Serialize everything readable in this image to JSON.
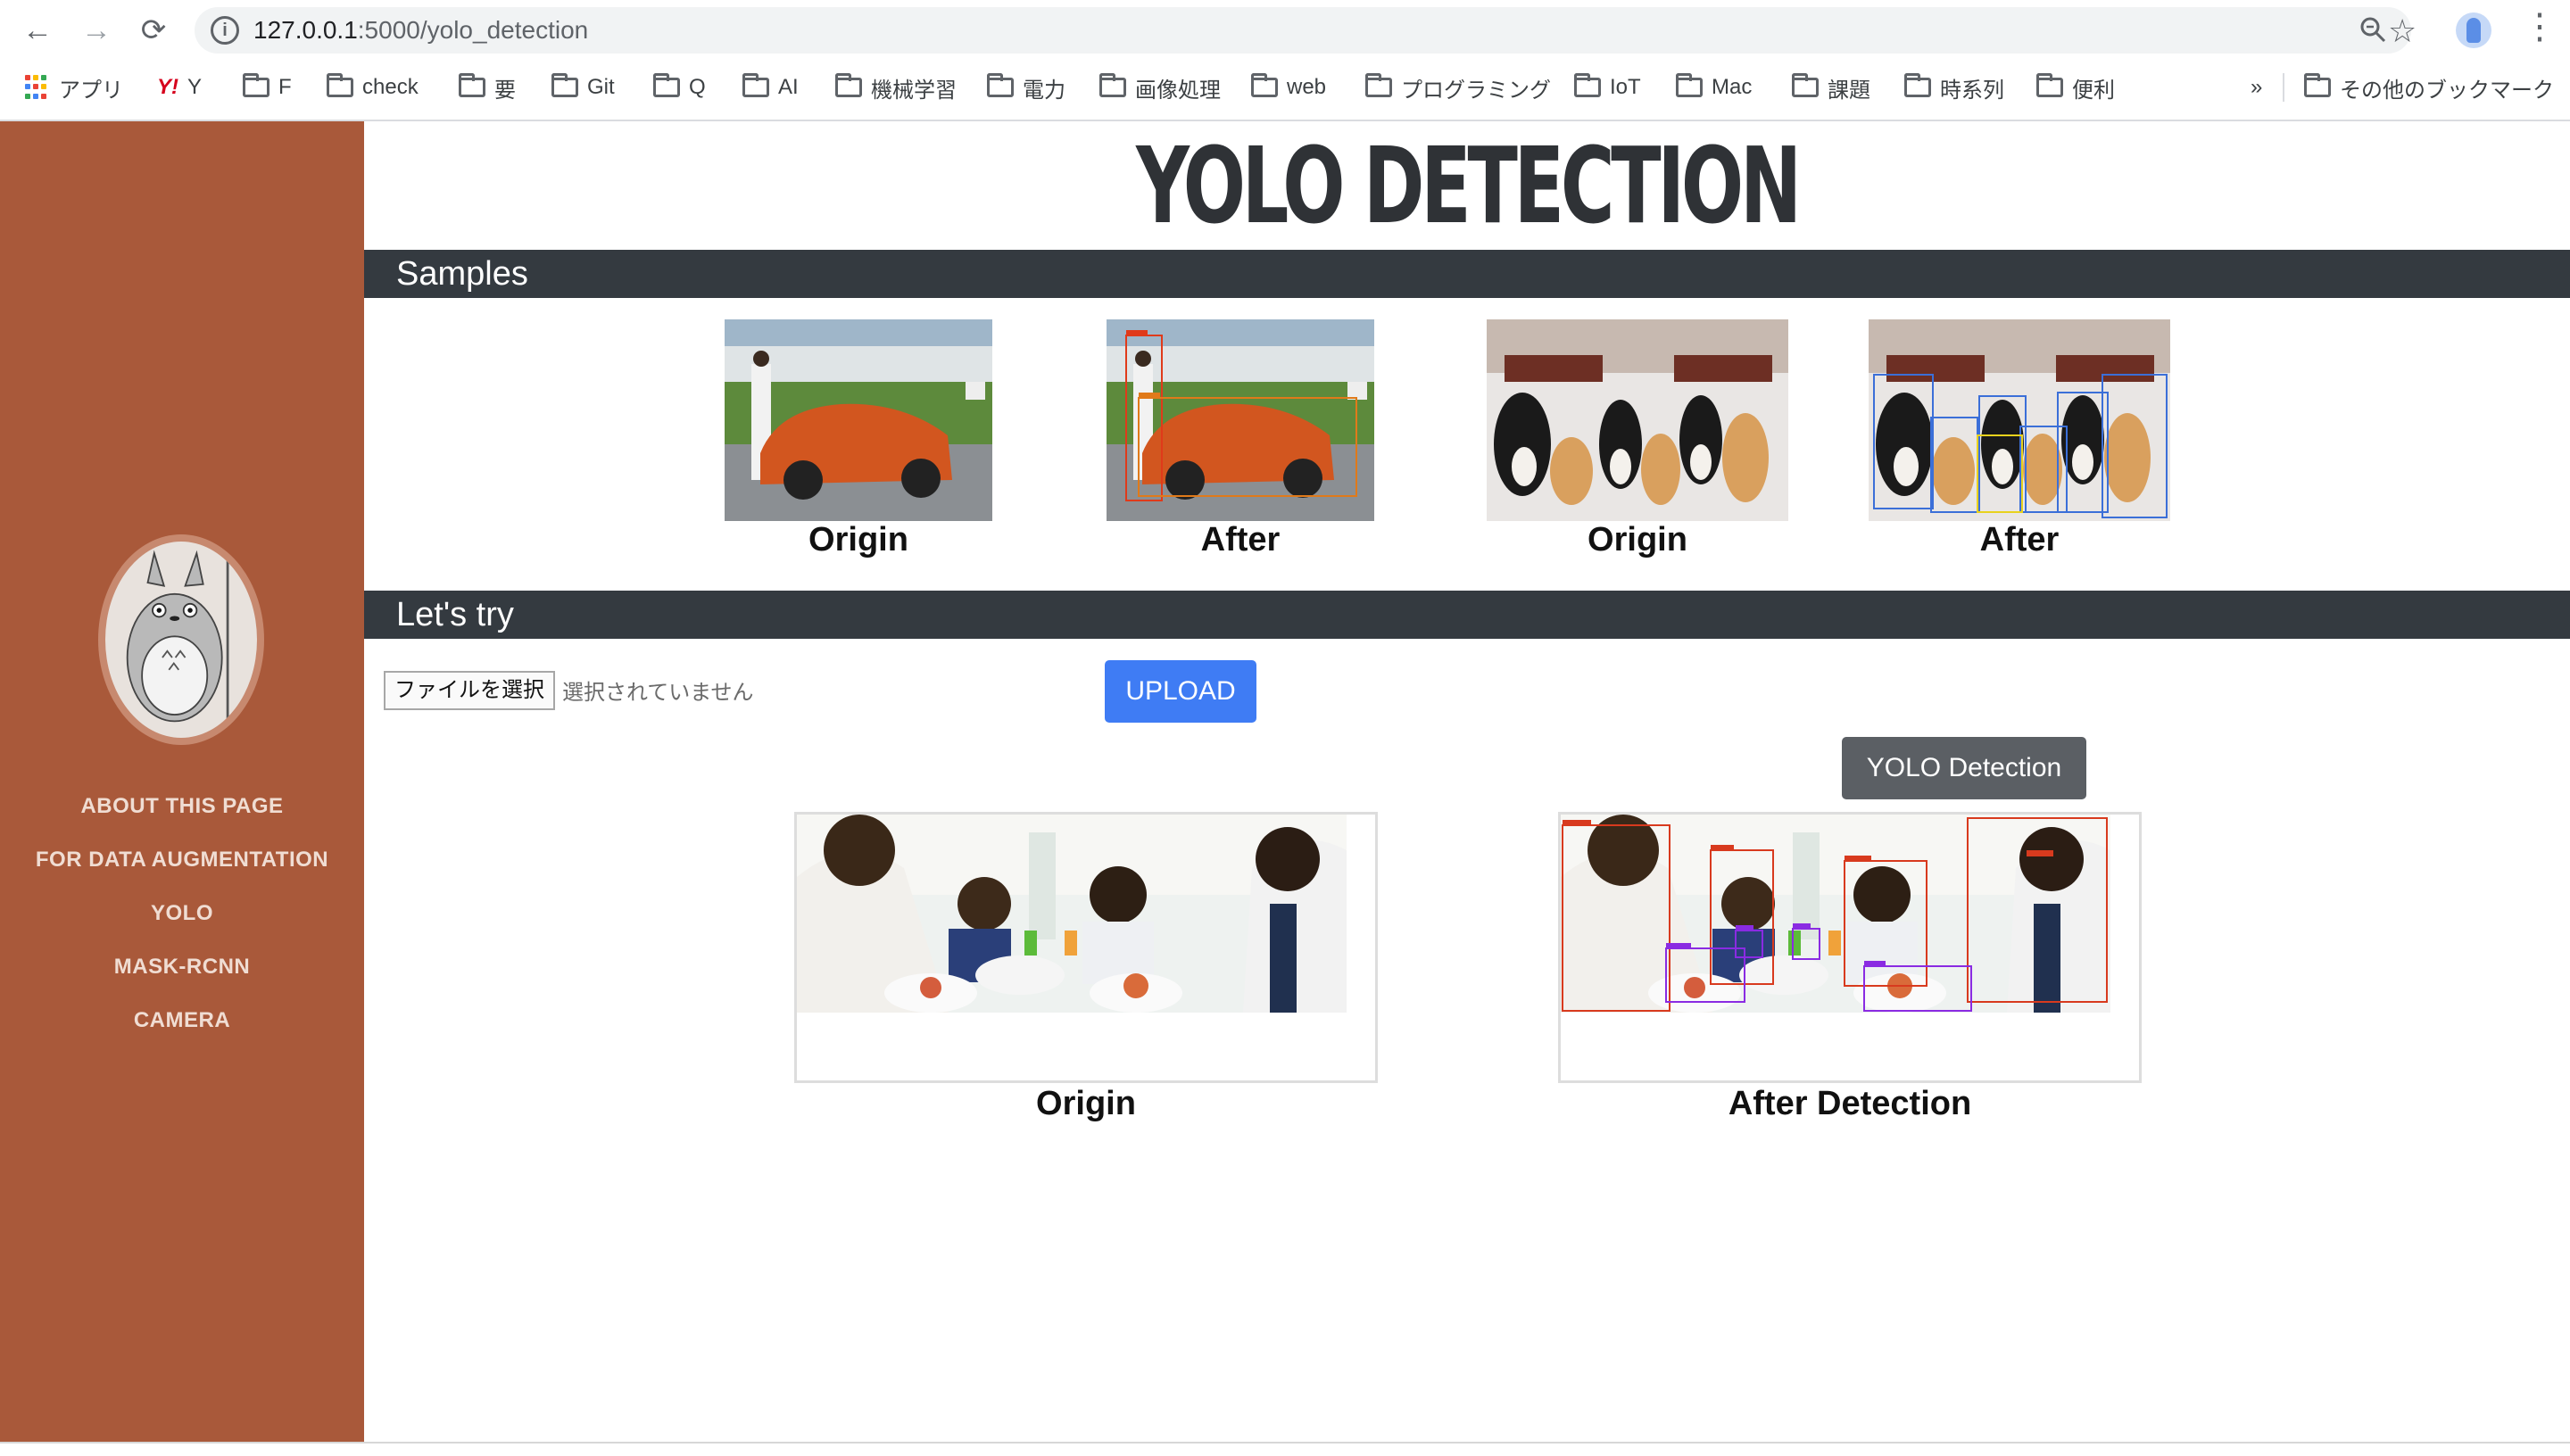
{
  "browser": {
    "url_host": "127.0.0.1",
    "url_path": ":5000/yolo_detection",
    "bookmarks": [
      {
        "label": "アプリ",
        "icon": "apps-grid-icon"
      },
      {
        "label": "Y",
        "icon": "yahoo-icon"
      },
      {
        "label": "F",
        "icon": "folder-icon"
      },
      {
        "label": "check",
        "icon": "folder-icon"
      },
      {
        "label": "要",
        "icon": "folder-icon"
      },
      {
        "label": "Git",
        "icon": "folder-icon"
      },
      {
        "label": "Q",
        "icon": "folder-icon"
      },
      {
        "label": "AI",
        "icon": "folder-icon"
      },
      {
        "label": "機械学習",
        "icon": "folder-icon"
      },
      {
        "label": "電力",
        "icon": "folder-icon"
      },
      {
        "label": "画像処理",
        "icon": "folder-icon"
      },
      {
        "label": "web",
        "icon": "folder-icon"
      },
      {
        "label": "プログラミング",
        "icon": "folder-icon"
      },
      {
        "label": "IoT",
        "icon": "folder-icon"
      },
      {
        "label": "Mac",
        "icon": "folder-icon"
      },
      {
        "label": "課題",
        "icon": "folder-icon"
      },
      {
        "label": "時系列",
        "icon": "folder-icon"
      },
      {
        "label": "便利",
        "icon": "folder-icon"
      }
    ],
    "overflow_label": "»",
    "other_bookmarks": "その他のブックマーク"
  },
  "sidebar": {
    "nav": [
      "ABOUT THIS PAGE",
      "FOR DATA AUGMENTATION",
      "YOLO",
      "MASK-RCNN",
      "CAMERA"
    ]
  },
  "page": {
    "title": "YOLO DETECTION",
    "samples_heading": "Samples",
    "sample_captions": [
      "Origin",
      "After",
      "Origin",
      "After"
    ],
    "try_heading": "Let's try",
    "file_button": "ファイルを選択",
    "file_status": "選択されていません",
    "upload_button": "UPLOAD",
    "yolo_button": "YOLO Detection",
    "result_captions": [
      "Origin",
      "After Detection"
    ]
  },
  "colors": {
    "sidebar_bg": "#a9593a",
    "section_bar": "#343a40",
    "upload_btn": "#3f7cf4",
    "yolo_btn": "#5b5f64"
  }
}
